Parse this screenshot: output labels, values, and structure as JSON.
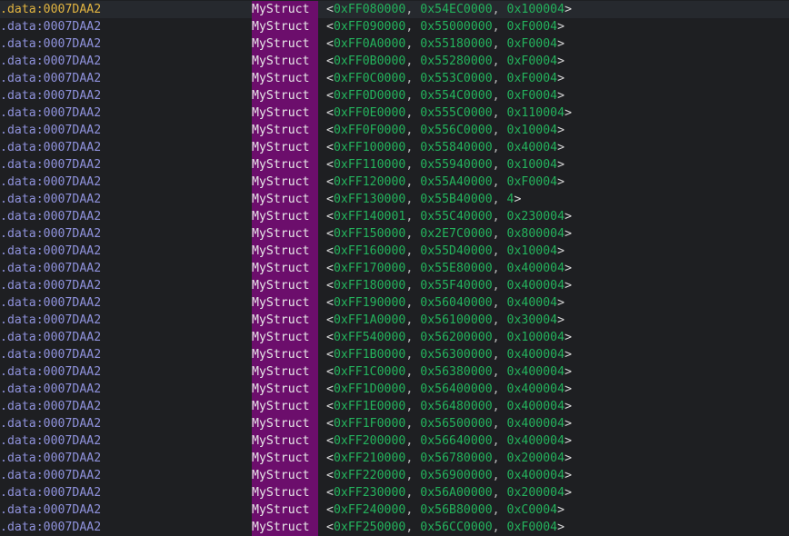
{
  "listing": {
    "rows": [
      {
        "address": ".data:0007DAA2",
        "type": "MyStruct",
        "values": [
          "0xFF080000",
          "0x54EC0000",
          "0x100004"
        ]
      },
      {
        "address": ".data:0007DAA2",
        "type": "MyStruct",
        "values": [
          "0xFF090000",
          "0x55000000",
          "0xF0004"
        ]
      },
      {
        "address": ".data:0007DAA2",
        "type": "MyStruct",
        "values": [
          "0xFF0A0000",
          "0x55180000",
          "0xF0004"
        ]
      },
      {
        "address": ".data:0007DAA2",
        "type": "MyStruct",
        "values": [
          "0xFF0B0000",
          "0x55280000",
          "0xF0004"
        ]
      },
      {
        "address": ".data:0007DAA2",
        "type": "MyStruct",
        "values": [
          "0xFF0C0000",
          "0x553C0000",
          "0xF0004"
        ]
      },
      {
        "address": ".data:0007DAA2",
        "type": "MyStruct",
        "values": [
          "0xFF0D0000",
          "0x554C0000",
          "0xF0004"
        ]
      },
      {
        "address": ".data:0007DAA2",
        "type": "MyStruct",
        "values": [
          "0xFF0E0000",
          "0x555C0000",
          "0x110004"
        ]
      },
      {
        "address": ".data:0007DAA2",
        "type": "MyStruct",
        "values": [
          "0xFF0F0000",
          "0x556C0000",
          "0x10004"
        ]
      },
      {
        "address": ".data:0007DAA2",
        "type": "MyStruct",
        "values": [
          "0xFF100000",
          "0x55840000",
          "0x40004"
        ]
      },
      {
        "address": ".data:0007DAA2",
        "type": "MyStruct",
        "values": [
          "0xFF110000",
          "0x55940000",
          "0x10004"
        ]
      },
      {
        "address": ".data:0007DAA2",
        "type": "MyStruct",
        "values": [
          "0xFF120000",
          "0x55A40000",
          "0xF0004"
        ]
      },
      {
        "address": ".data:0007DAA2",
        "type": "MyStruct",
        "values": [
          "0xFF130000",
          "0x55B40000",
          "4"
        ]
      },
      {
        "address": ".data:0007DAA2",
        "type": "MyStruct",
        "values": [
          "0xFF140001",
          "0x55C40000",
          "0x230004"
        ]
      },
      {
        "address": ".data:0007DAA2",
        "type": "MyStruct",
        "values": [
          "0xFF150000",
          "0x2E7C0000",
          "0x800004"
        ]
      },
      {
        "address": ".data:0007DAA2",
        "type": "MyStruct",
        "values": [
          "0xFF160000",
          "0x55D40000",
          "0x10004"
        ]
      },
      {
        "address": ".data:0007DAA2",
        "type": "MyStruct",
        "values": [
          "0xFF170000",
          "0x55E80000",
          "0x400004"
        ]
      },
      {
        "address": ".data:0007DAA2",
        "type": "MyStruct",
        "values": [
          "0xFF180000",
          "0x55F40000",
          "0x400004"
        ]
      },
      {
        "address": ".data:0007DAA2",
        "type": "MyStruct",
        "values": [
          "0xFF190000",
          "0x56040000",
          "0x40004"
        ]
      },
      {
        "address": ".data:0007DAA2",
        "type": "MyStruct",
        "values": [
          "0xFF1A0000",
          "0x56100000",
          "0x30004"
        ]
      },
      {
        "address": ".data:0007DAA2",
        "type": "MyStruct",
        "values": [
          "0xFF540000",
          "0x56200000",
          "0x100004"
        ]
      },
      {
        "address": ".data:0007DAA2",
        "type": "MyStruct",
        "values": [
          "0xFF1B0000",
          "0x56300000",
          "0x400004"
        ]
      },
      {
        "address": ".data:0007DAA2",
        "type": "MyStruct",
        "values": [
          "0xFF1C0000",
          "0x56380000",
          "0x400004"
        ]
      },
      {
        "address": ".data:0007DAA2",
        "type": "MyStruct",
        "values": [
          "0xFF1D0000",
          "0x56400000",
          "0x400004"
        ]
      },
      {
        "address": ".data:0007DAA2",
        "type": "MyStruct",
        "values": [
          "0xFF1E0000",
          "0x56480000",
          "0x400004"
        ]
      },
      {
        "address": ".data:0007DAA2",
        "type": "MyStruct",
        "values": [
          "0xFF1F0000",
          "0x56500000",
          "0x400004"
        ]
      },
      {
        "address": ".data:0007DAA2",
        "type": "MyStruct",
        "values": [
          "0xFF200000",
          "0x56640000",
          "0x400004"
        ]
      },
      {
        "address": ".data:0007DAA2",
        "type": "MyStruct",
        "values": [
          "0xFF210000",
          "0x56780000",
          "0x200004"
        ]
      },
      {
        "address": ".data:0007DAA2",
        "type": "MyStruct",
        "values": [
          "0xFF220000",
          "0x56900000",
          "0x400004"
        ]
      },
      {
        "address": ".data:0007DAA2",
        "type": "MyStruct",
        "values": [
          "0xFF230000",
          "0x56A00000",
          "0x200004"
        ]
      },
      {
        "address": ".data:0007DAA2",
        "type": "MyStruct",
        "values": [
          "0xFF240000",
          "0x56B80000",
          "0xC0004"
        ]
      },
      {
        "address": ".data:0007DAA2",
        "type": "MyStruct",
        "values": [
          "0xFF250000",
          "0x56CC0000",
          "0xF0004"
        ]
      }
    ]
  },
  "colors": {
    "background": "#1e1f22",
    "address": "#8f92dc",
    "address_current": "#e1b441",
    "type_highlight": "#6c0e6c",
    "number": "#24b35d"
  }
}
